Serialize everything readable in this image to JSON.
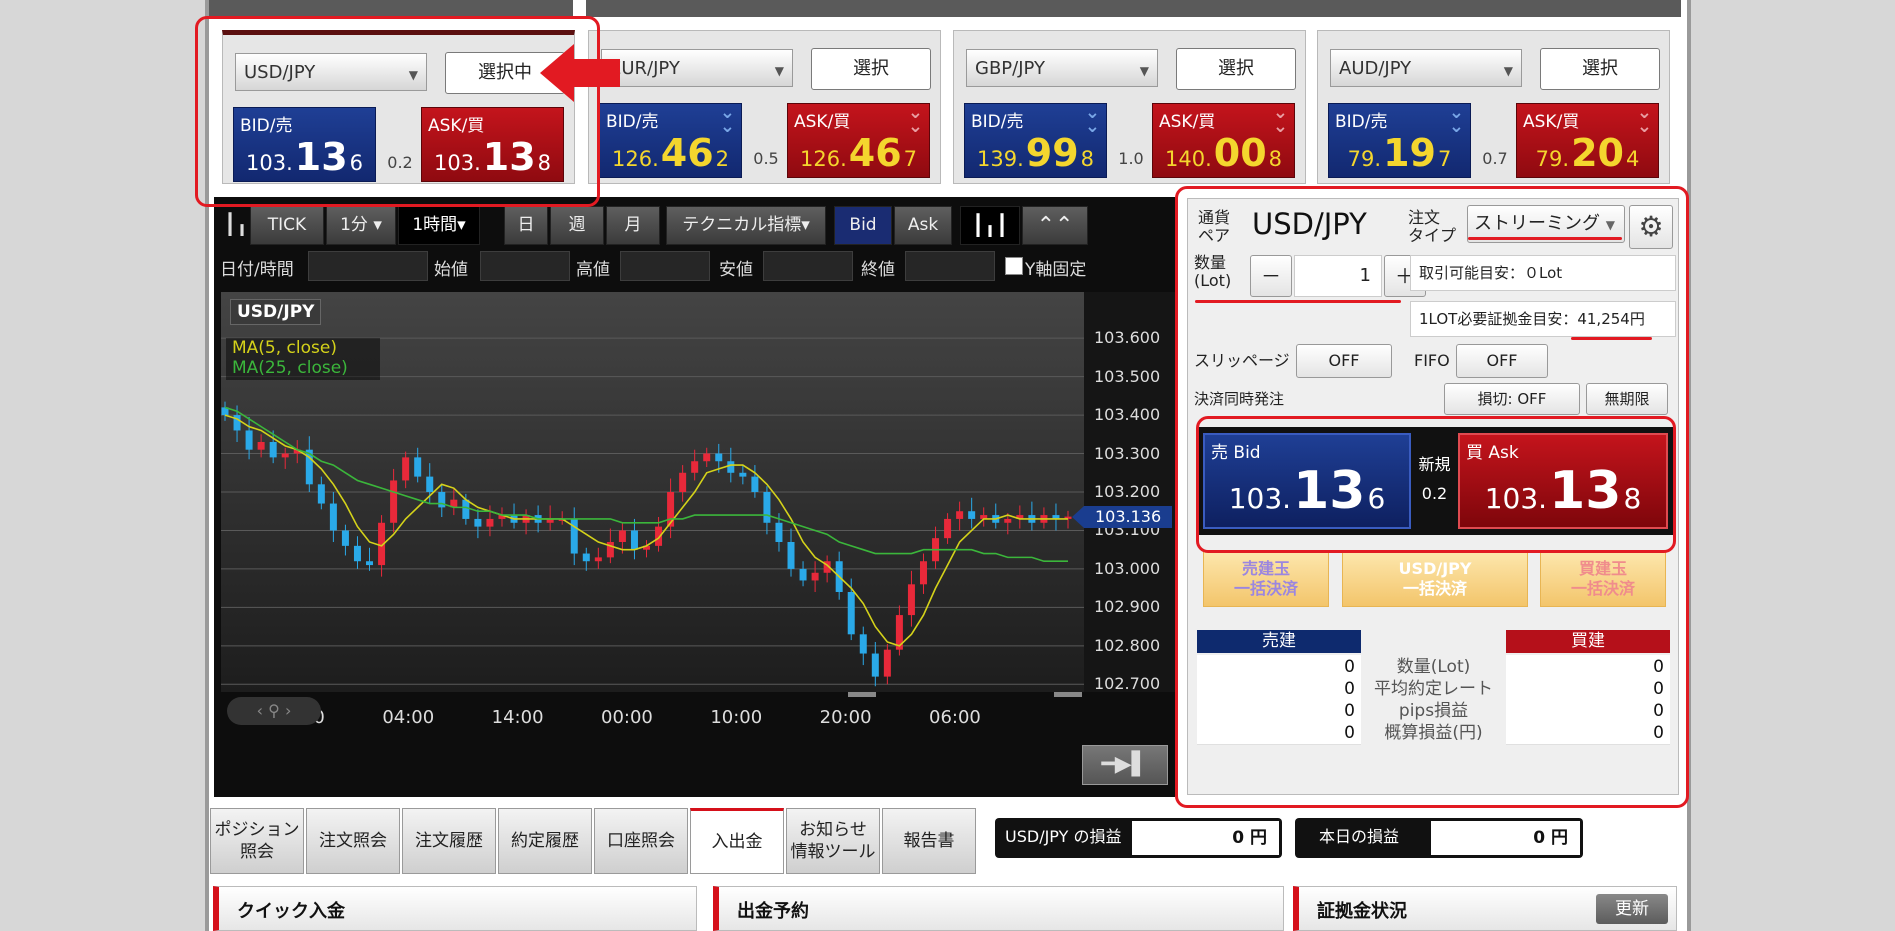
{
  "panels": [
    {
      "pair": "USD/JPY",
      "select_label": "選択中",
      "bid_label": "BID/売",
      "bid_small": "103.",
      "bid_big": "13",
      "bid_tail": "6",
      "ask_label": "ASK/買",
      "ask_small": "103.",
      "ask_big": "13",
      "ask_tail": "8",
      "spread": "0.2"
    },
    {
      "pair": "EUR/JPY",
      "select_label": "選択",
      "bid_label": "BID/売",
      "bid_small": "126.",
      "bid_big": "46",
      "bid_tail": "2",
      "ask_label": "ASK/買",
      "ask_small": "126.",
      "ask_big": "46",
      "ask_tail": "7",
      "spread": "0.5"
    },
    {
      "pair": "GBP/JPY",
      "select_label": "選択",
      "bid_label": "BID/売",
      "bid_small": "139.",
      "bid_big": "99",
      "bid_tail": "8",
      "ask_label": "ASK/買",
      "ask_small": "140.",
      "ask_big": "00",
      "ask_tail": "8",
      "spread": "1.0"
    },
    {
      "pair": "AUD/JPY",
      "select_label": "選択",
      "bid_label": "BID/売",
      "bid_small": "79.",
      "bid_big": "19",
      "bid_tail": "7",
      "ask_label": "ASK/買",
      "ask_small": "79.",
      "ask_big": "20",
      "ask_tail": "4",
      "spread": "0.7"
    }
  ],
  "chart": {
    "toolbar": {
      "tick": "TICK",
      "interval": "1分",
      "selected_interval": "1時間",
      "day": "日",
      "week": "週",
      "month": "月",
      "technical": "テクニカル指標",
      "bid": "Bid",
      "ask": "Ask"
    },
    "fields": {
      "datetime": "日付/時間",
      "open": "始値",
      "high": "高値",
      "low": "安値",
      "close": "終値",
      "y_fixed": "Y軸固定"
    },
    "pair_tag": "USD/JPY",
    "ma5": "MA(5, close)",
    "ma25": "MA(25, close)",
    "current_price": "103.136",
    "y_ticks": [
      "103.600",
      "103.500",
      "103.400",
      "103.300",
      "103.200",
      "103.100",
      "103.000",
      "102.900",
      "102.800",
      "102.700"
    ],
    "x_ticks": [
      "18:00",
      "04:00",
      "14:00",
      "00:00",
      "10:00",
      "20:00",
      "06:00"
    ],
    "colors": {
      "up": "#e8293a",
      "down": "#2aa9e8",
      "ma5": "#d4d21a",
      "ma25": "#3bb63b"
    }
  },
  "chart_data": {
    "type": "line",
    "title": "",
    "ylim": [
      102.68,
      103.72
    ],
    "close": [
      103.4,
      103.36,
      103.31,
      103.33,
      103.29,
      103.3,
      103.31,
      103.22,
      103.17,
      103.1,
      103.06,
      103.02,
      103.01,
      103.12,
      103.23,
      103.29,
      103.24,
      103.2,
      103.16,
      103.18,
      103.13,
      103.11,
      103.13,
      103.14,
      103.12,
      103.14,
      103.12,
      103.13,
      103.13,
      103.04,
      103.02,
      103.03,
      103.07,
      103.1,
      103.05,
      103.06,
      103.11,
      103.2,
      103.25,
      103.28,
      103.3,
      103.28,
      103.25,
      103.24,
      103.2,
      103.12,
      103.07,
      103.0,
      102.97,
      102.99,
      103.02,
      102.94,
      102.83,
      102.78,
      102.72,
      102.79,
      102.88,
      102.96,
      103.02,
      103.08,
      103.13,
      103.15,
      103.13,
      103.14,
      103.12,
      103.13,
      103.14,
      103.12,
      103.14,
      103.13,
      103.136
    ],
    "series": [
      {
        "name": "MA(5, close)",
        "values": [
          103.4,
          103.39,
          103.37,
          103.36,
          103.34,
          103.32,
          103.31,
          103.29,
          103.26,
          103.22,
          103.17,
          103.11,
          103.07,
          103.06,
          103.09,
          103.13,
          103.16,
          103.19,
          103.22,
          103.21,
          103.18,
          103.16,
          103.15,
          103.14,
          103.13,
          103.13,
          103.13,
          103.13,
          103.13,
          103.11,
          103.09,
          103.07,
          103.06,
          103.05,
          103.05,
          103.06,
          103.08,
          103.12,
          103.16,
          103.2,
          103.25,
          103.26,
          103.27,
          103.27,
          103.25,
          103.22,
          103.18,
          103.13,
          103.07,
          103.03,
          103.01,
          102.98,
          102.95,
          102.91,
          102.85,
          102.81,
          102.8,
          102.83,
          102.88,
          102.95,
          103.01,
          103.07,
          103.1,
          103.13,
          103.13,
          103.14,
          103.13,
          103.13,
          103.13,
          103.13,
          103.13
        ]
      },
      {
        "name": "MA(25, close)",
        "values": [
          103.42,
          103.41,
          103.39,
          103.37,
          103.35,
          103.33,
          103.31,
          103.3,
          103.28,
          103.27,
          103.25,
          103.23,
          103.22,
          103.21,
          103.2,
          103.19,
          103.18,
          103.17,
          103.17,
          103.16,
          103.16,
          103.15,
          103.15,
          103.14,
          103.14,
          103.14,
          103.13,
          103.13,
          103.13,
          103.13,
          103.13,
          103.13,
          103.13,
          103.12,
          103.12,
          103.12,
          103.12,
          103.13,
          103.13,
          103.14,
          103.14,
          103.14,
          103.14,
          103.14,
          103.14,
          103.14,
          103.13,
          103.12,
          103.11,
          103.1,
          103.09,
          103.07,
          103.06,
          103.05,
          103.04,
          103.04,
          103.04,
          103.04,
          103.05,
          103.05,
          103.05,
          103.05,
          103.05,
          103.04,
          103.04,
          103.03,
          103.03,
          103.03,
          103.02,
          103.02,
          103.02
        ]
      }
    ]
  },
  "order": {
    "pair_label": "通貨\nペア",
    "pair": "USD/JPY",
    "type_label": "注文\nタイプ",
    "type_value": "ストリーミング",
    "qty_label": "数量\n(Lot)",
    "minus": "－",
    "qty": "1",
    "plus": "＋",
    "available": "取引可能目安：０Lot",
    "margin_label": "1LOT必要証拠金目安：",
    "margin_value": "41,254円",
    "slippage_label": "スリッページ",
    "slippage_value": "OFF",
    "fifo_label": "FIFO",
    "fifo_value": "OFF",
    "settle_label": "決済同時発注",
    "stop_value": "損切: OFF",
    "limit_value": "無期限",
    "sell_label": "売 Bid",
    "sell_small": "103.",
    "sell_big": "13",
    "sell_tail": "6",
    "new_label": "新規",
    "spread": "0.2",
    "buy_label": "買 Ask",
    "buy_small": "103.",
    "buy_big": "13",
    "buy_tail": "8",
    "settle_sell": "売建玉\n一括決済",
    "settle_pair": "USD/JPY\n一括決済",
    "settle_buy": "買建玉\n一括決済",
    "sell_head": "売建",
    "buy_head": "買建",
    "rows": [
      {
        "label": "数量(Lot)",
        "sell": "0",
        "buy": "0"
      },
      {
        "label": "平均約定レート",
        "sell": "0",
        "buy": "0"
      },
      {
        "label": "pips損益",
        "sell": "0",
        "buy": "0"
      },
      {
        "label": "概算損益(円)",
        "sell": "0",
        "buy": "0"
      }
    ]
  },
  "tabs": [
    "ポジション\n照会",
    "注文照会",
    "注文履歴",
    "約定履歴",
    "口座照会",
    "入出金",
    "お知らせ\n情報ツール",
    "報告書"
  ],
  "pl": {
    "pair_label": "USD/JPY の損益",
    "pair_value": "0 円",
    "today_label": "本日の損益",
    "today_value": "0 円"
  },
  "bottom": {
    "quick": "クイック入金",
    "withdraw": "出金予約",
    "margin": "証拠金状況",
    "refresh": "更新"
  }
}
